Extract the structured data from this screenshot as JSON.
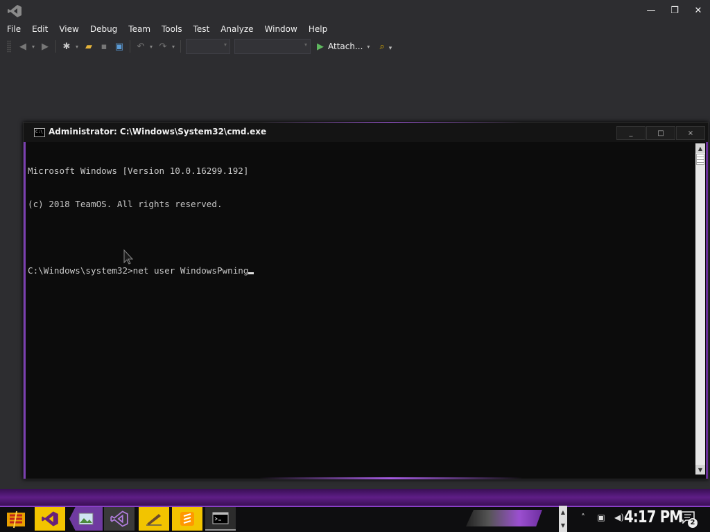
{
  "vs": {
    "menu": [
      "File",
      "Edit",
      "View",
      "Debug",
      "Team",
      "Tools",
      "Test",
      "Analyze",
      "Window",
      "Help"
    ],
    "toolbar": {
      "attach_label": "Attach...",
      "config_combo": "",
      "platform_combo": ""
    },
    "window_controls": {
      "minimize": "—",
      "restore": "❐",
      "close": "✕"
    }
  },
  "cmd": {
    "title": "Administrator: C:\\Windows\\System32\\cmd.exe",
    "icon_text": "C:\\",
    "controls": {
      "minimize": "_",
      "maximize": "□",
      "close": "×"
    },
    "lines": [
      "Microsoft Windows [Version 10.0.16299.192]",
      "(c) 2018 TeamOS. All rights reserved.",
      "",
      "C:\\Windows\\system32>net user WindowsPwning"
    ]
  },
  "taskbar": {
    "clock": "4:17 PM",
    "notification_count": "2",
    "apps": [
      "start-menu",
      "visual-studio",
      "photo-viewer",
      "visual-studio-installer",
      "sketch-editor",
      "sublime-text",
      "command-prompt"
    ]
  },
  "colors": {
    "accent_purple": "#7a3fb0",
    "taskbar_yellow": "#f2c400",
    "vs_background": "#2d2d30"
  }
}
